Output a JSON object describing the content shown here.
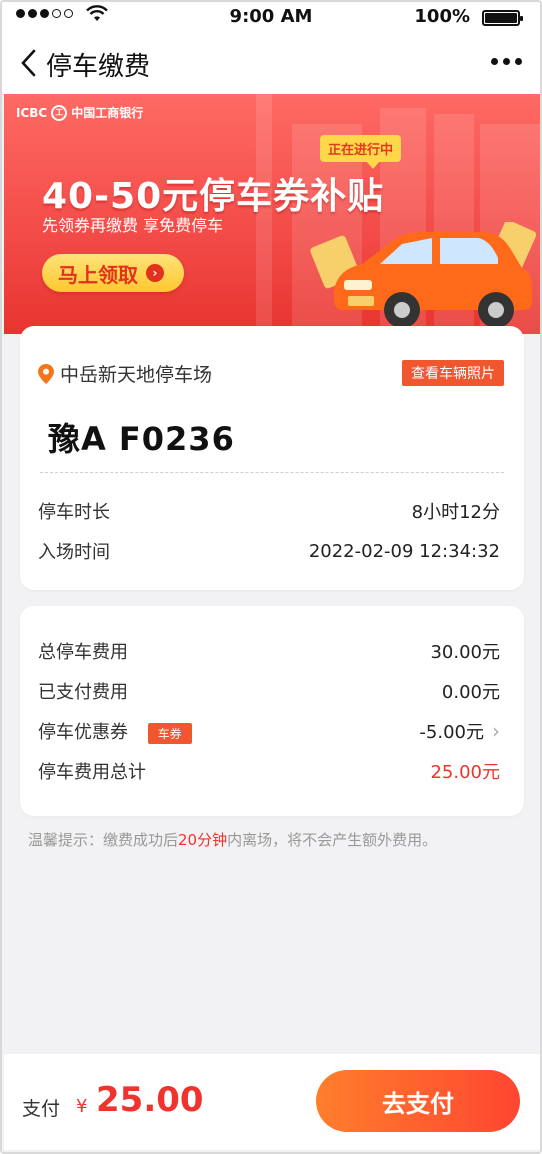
{
  "status_bar": {
    "time": "9:00 AM",
    "battery": "100%"
  },
  "nav": {
    "title": "停车缴费"
  },
  "banner": {
    "logo_text": "ICBC",
    "logo_seal": "工",
    "bank_name": "中国工商银行",
    "badge": "正在进行中",
    "headline": "40-50元停车券补贴",
    "subtitle": "先领券再缴费  享免费停车",
    "cta": "马上领取"
  },
  "parking": {
    "location": "中岳新天地停车场",
    "photo_button": "查看车辆照片",
    "plate": "豫A F0236",
    "duration_label": "停车时长",
    "duration_value": "8小时12分",
    "entry_label": "入场时间",
    "entry_value": "2022-02-09 12:34:32"
  },
  "fees": {
    "total_label": "总停车费用",
    "total_value": "30.00元",
    "paid_label": "已支付费用",
    "paid_value": "0.00元",
    "coupon_label": "停车优惠券",
    "coupon_tag": "车券",
    "coupon_value": "-5.00元",
    "sum_label": "停车费用总计",
    "sum_value": "25.00元"
  },
  "tip": {
    "prefix": "温馨提示：缴费成功后",
    "highlight": "20分钟",
    "suffix": "内离场，将不会产生额外费用。"
  },
  "footer": {
    "pay_label": "支付",
    "currency": "¥",
    "amount": "25.00",
    "button": "去支付"
  },
  "colors": {
    "accent": "#f0332d",
    "tag": "#f0572f",
    "button_from": "#ff7e2c",
    "button_to": "#ff4531"
  }
}
